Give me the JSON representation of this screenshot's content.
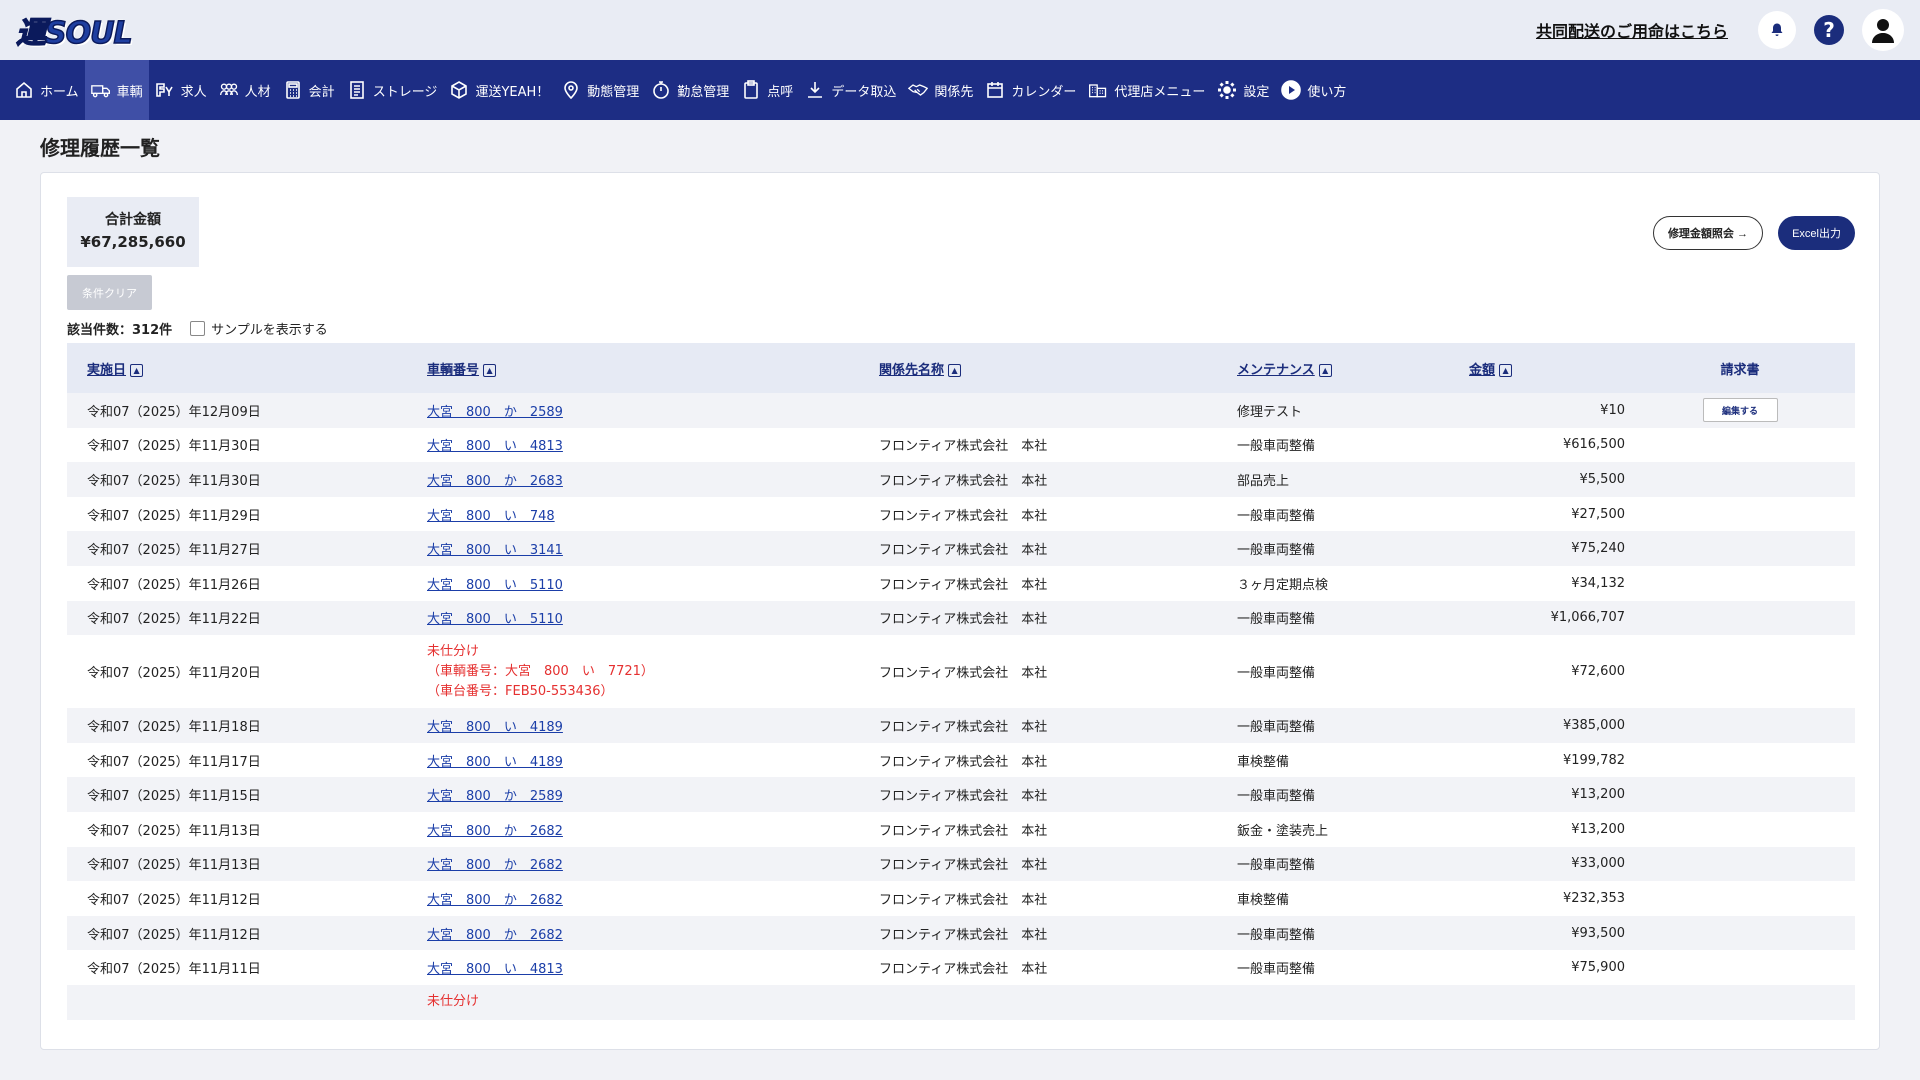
{
  "header": {
    "logo_text": "運SOUL",
    "coop_link": "共同配送のご用命はこちら",
    "help_label": "?"
  },
  "nav": [
    {
      "label": "ホーム",
      "icon": "home-icon",
      "active": false
    },
    {
      "label": "車輌",
      "icon": "truck-icon",
      "active": true
    },
    {
      "label": "求人",
      "icon": "job-icon",
      "active": false
    },
    {
      "label": "人材",
      "icon": "people-icon",
      "active": false
    },
    {
      "label": "会計",
      "icon": "calculator-icon",
      "active": false
    },
    {
      "label": "ストレージ",
      "icon": "document-icon",
      "active": false
    },
    {
      "label": "運送YEAH！",
      "icon": "cube-icon",
      "active": false
    },
    {
      "label": "動態管理",
      "icon": "location-pin-icon",
      "active": false
    },
    {
      "label": "勤怠管理",
      "icon": "timer-icon",
      "active": false
    },
    {
      "label": "点呼",
      "icon": "clipboard-icon",
      "active": false
    },
    {
      "label": "データ取込",
      "icon": "download-icon",
      "active": false
    },
    {
      "label": "関係先",
      "icon": "handshake-icon",
      "active": false
    },
    {
      "label": "カレンダー",
      "icon": "calendar-icon",
      "active": false
    },
    {
      "label": "代理店メニュー",
      "icon": "building-icon",
      "active": false
    },
    {
      "label": "設定",
      "icon": "gear-icon",
      "active": false
    },
    {
      "label": "使い方",
      "icon": "play-icon",
      "active": false
    }
  ],
  "page": {
    "title": "修理履歴一覧",
    "total_label": "合計金額",
    "total_value": "¥67,285,660",
    "clear_button": "条件クリア",
    "repair_button": "修理金額照会 →",
    "excel_button": "Excel出力",
    "count_text": "該当件数：312件",
    "sample_label": "サンプルを表示する"
  },
  "table": {
    "headers": [
      "実施日",
      "車輌番号",
      "関係先名称",
      "メンテナンス",
      "金額",
      "請求書"
    ],
    "edit_button": "編集する",
    "rows": [
      {
        "date": "令和07（2025）年12月09日",
        "vehicle": "大宮　800　か　2589",
        "partner": "",
        "maintenance": "修理テスト",
        "amount": "¥10",
        "edit": true
      },
      {
        "date": "令和07（2025）年11月30日",
        "vehicle": "大宮　800　い　4813",
        "partner": "フロンティア株式会社　本社",
        "maintenance": "一般車両整備",
        "amount": "¥616,500"
      },
      {
        "date": "令和07（2025）年11月30日",
        "vehicle": "大宮　800　か　2683",
        "partner": "フロンティア株式会社　本社",
        "maintenance": "部品売上",
        "amount": "¥5,500"
      },
      {
        "date": "令和07（2025）年11月29日",
        "vehicle": "大宮　800　い　748",
        "partner": "フロンティア株式会社　本社",
        "maintenance": "一般車両整備",
        "amount": "¥27,500"
      },
      {
        "date": "令和07（2025）年11月27日",
        "vehicle": "大宮　800　い　3141",
        "partner": "フロンティア株式会社　本社",
        "maintenance": "一般車両整備",
        "amount": "¥75,240"
      },
      {
        "date": "令和07（2025）年11月26日",
        "vehicle": "大宮　800　い　5110",
        "partner": "フロンティア株式会社　本社",
        "maintenance": "３ヶ月定期点検",
        "amount": "¥34,132"
      },
      {
        "date": "令和07（2025）年11月22日",
        "vehicle": "大宮　800　い　5110",
        "partner": "フロンティア株式会社　本社",
        "maintenance": "一般車両整備",
        "amount": "¥1,066,707"
      },
      {
        "date": "令和07（2025）年11月20日",
        "unassigned": [
          "未仕分け",
          "（車輌番号：大宮　800　い　7721）",
          "（車台番号：FEB50-553436）"
        ],
        "partner": "フロンティア株式会社　本社",
        "maintenance": "一般車両整備",
        "amount": "¥72,600"
      },
      {
        "date": "令和07（2025）年11月18日",
        "vehicle": "大宮　800　い　4189",
        "partner": "フロンティア株式会社　本社",
        "maintenance": "一般車両整備",
        "amount": "¥385,000"
      },
      {
        "date": "令和07（2025）年11月17日",
        "vehicle": "大宮　800　い　4189",
        "partner": "フロンティア株式会社　本社",
        "maintenance": "車検整備",
        "amount": "¥199,782"
      },
      {
        "date": "令和07（2025）年11月15日",
        "vehicle": "大宮　800　か　2589",
        "partner": "フロンティア株式会社　本社",
        "maintenance": "一般車両整備",
        "amount": "¥13,200"
      },
      {
        "date": "令和07（2025）年11月13日",
        "vehicle": "大宮　800　か　2682",
        "partner": "フロンティア株式会社　本社",
        "maintenance": "鈑金・塗装売上",
        "amount": "¥13,200"
      },
      {
        "date": "令和07（2025）年11月13日",
        "vehicle": "大宮　800　か　2682",
        "partner": "フロンティア株式会社　本社",
        "maintenance": "一般車両整備",
        "amount": "¥33,000"
      },
      {
        "date": "令和07（2025）年11月12日",
        "vehicle": "大宮　800　か　2682",
        "partner": "フロンティア株式会社　本社",
        "maintenance": "車検整備",
        "amount": "¥232,353"
      },
      {
        "date": "令和07（2025）年11月12日",
        "vehicle": "大宮　800　か　2682",
        "partner": "フロンティア株式会社　本社",
        "maintenance": "一般車両整備",
        "amount": "¥93,500"
      },
      {
        "date": "令和07（2025）年11月11日",
        "vehicle": "大宮　800　い　4813",
        "partner": "フロンティア株式会社　本社",
        "maintenance": "一般車両整備",
        "amount": "¥75,900"
      },
      {
        "date": "",
        "unassigned": [
          "未仕分け"
        ],
        "partner": "",
        "maintenance": "",
        "amount": ""
      }
    ]
  },
  "colors": {
    "nav_bg": "#1d2d84",
    "accent": "#1b2d7c",
    "link": "#1b3ea8",
    "warning": "#e53030"
  }
}
